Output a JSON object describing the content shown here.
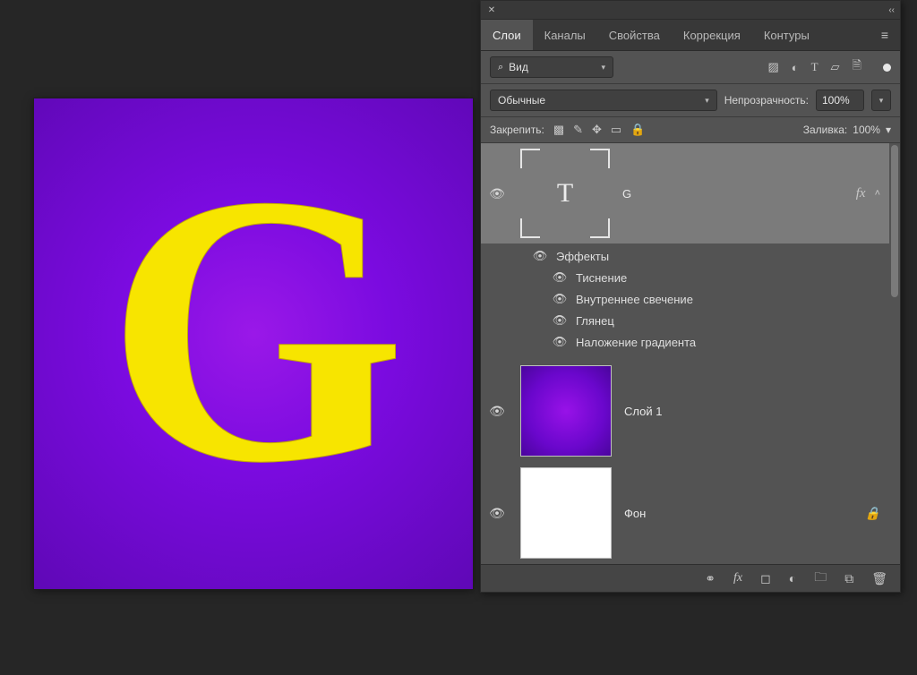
{
  "canvas": {
    "letter": "G"
  },
  "panel": {
    "tabs": [
      {
        "label": "Слои"
      },
      {
        "label": "Каналы"
      },
      {
        "label": "Свойства"
      },
      {
        "label": "Коррекция"
      },
      {
        "label": "Контуры"
      }
    ],
    "filter": {
      "search_text": "Вид"
    },
    "blend": {
      "mode": "Обычные",
      "opacity_label": "Непрозрачность:",
      "opacity_value": "100%"
    },
    "lock": {
      "label": "Закрепить:",
      "fill_label": "Заливка:",
      "fill_value": "100%"
    },
    "layers": [
      {
        "kind": "text",
        "name": "G",
        "selected": true,
        "has_fx": true,
        "effects_label": "Эффекты",
        "effects": [
          "Тиснение",
          "Внутреннее свечение",
          "Глянец",
          "Наложение градиента"
        ]
      },
      {
        "kind": "raster",
        "name": "Слой 1",
        "thumb": "purple"
      },
      {
        "kind": "raster",
        "name": "Фон",
        "thumb": "white",
        "locked": true
      }
    ]
  }
}
